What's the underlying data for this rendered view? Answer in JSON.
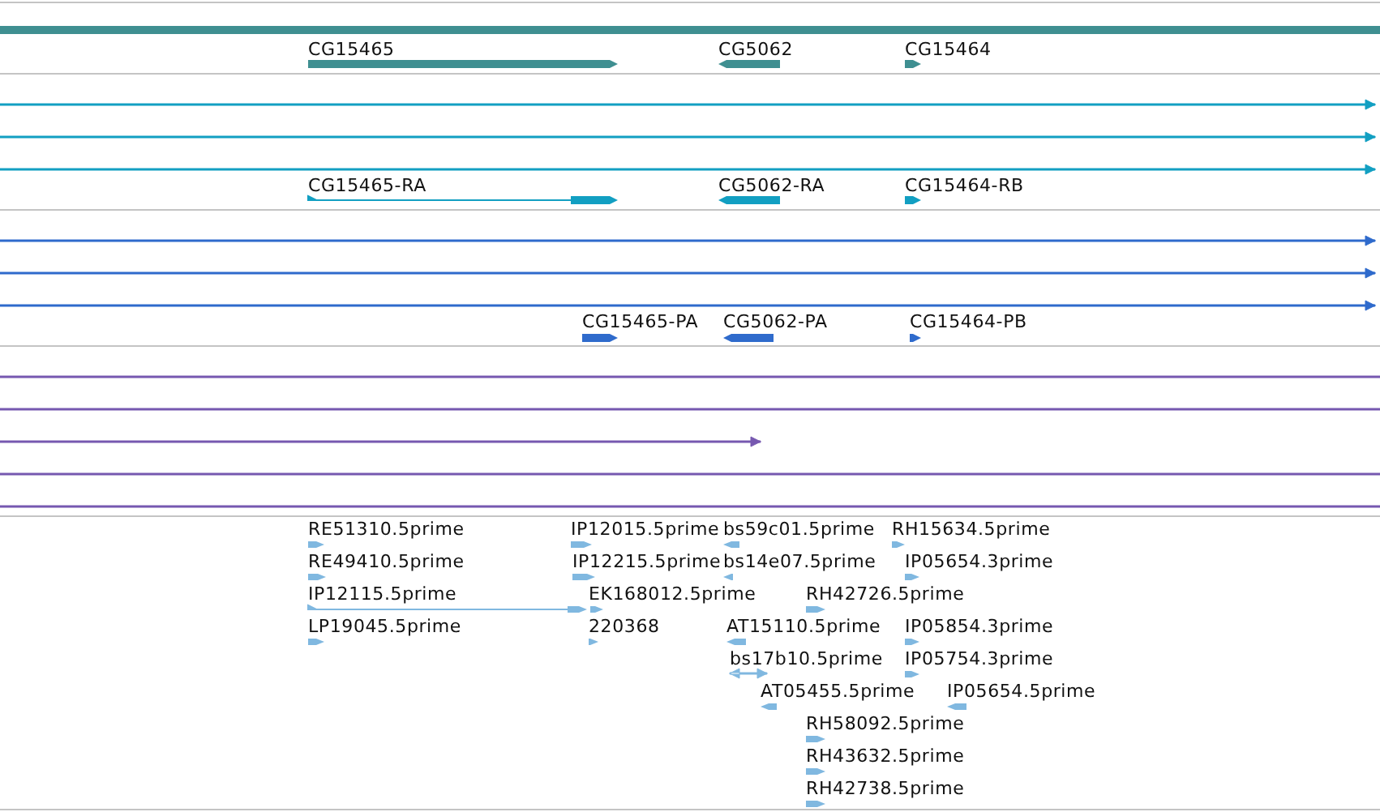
{
  "tracks": [
    {
      "kind": "gene",
      "features": [
        {
          "points_right": false,
          "points_left": false
        },
        {
          "label": "CG15465",
          "points_right": true,
          "points_left": false
        },
        {
          "label": "CG5062",
          "points_right": false,
          "points_left": true
        },
        {
          "label": "CG15464",
          "points_right": true,
          "points_left": false
        }
      ]
    },
    {
      "kind": "transcript",
      "features": [
        {
          "points_right": true,
          "points_left": false
        },
        {
          "points_right": true,
          "points_left": false
        },
        {
          "points_right": true,
          "points_left": false
        },
        {
          "label": "CG15465-RA",
          "points_right": true,
          "points_left": false
        },
        {
          "label": "CG5062-RA",
          "points_right": false,
          "points_left": true
        },
        {
          "label": "CG15464-RB",
          "points_right": true,
          "points_left": false
        }
      ]
    },
    {
      "kind": "protein",
      "features": [
        {
          "points_right": true,
          "points_left": false
        },
        {
          "points_right": true,
          "points_left": false
        },
        {
          "points_right": true,
          "points_left": false
        },
        {
          "label": "CG15465-PA",
          "points_right": true,
          "points_left": false
        },
        {
          "label": "CG5062-PA",
          "points_right": false,
          "points_left": true
        },
        {
          "label": "CG15464-PB",
          "points_right": true,
          "points_left": false
        }
      ]
    },
    {
      "kind": "alignment",
      "features": [
        {
          "points_right": false,
          "points_left": false
        },
        {
          "points_right": false,
          "points_left": false
        },
        {
          "points_right": true,
          "points_left": false
        },
        {
          "points_right": false,
          "points_left": false
        },
        {
          "points_right": false,
          "points_left": false
        }
      ]
    },
    {
      "kind": "est",
      "features": [
        {
          "label": "RE51310.5prime",
          "points_right": true,
          "points_left": false
        },
        {
          "label": "RE49410.5prime",
          "points_right": true,
          "points_left": false
        },
        {
          "label": "IP12115.5prime",
          "points_right": true,
          "points_left": false
        },
        {
          "label": "LP19045.5prime",
          "points_right": true,
          "points_left": false
        },
        {
          "label": "IP12015.5prime",
          "points_right": true,
          "points_left": false
        },
        {
          "label": "IP12215.5prime",
          "points_right": true,
          "points_left": false
        },
        {
          "label": "EK168012.5prime",
          "points_right": true,
          "points_left": false
        },
        {
          "label": "220368",
          "points_right": true,
          "points_left": false
        },
        {
          "label": "bs59c01.5prime",
          "points_right": false,
          "points_left": true
        },
        {
          "label": "bs14e07.5prime",
          "points_right": false,
          "points_left": true
        },
        {
          "label": "AT15110.5prime",
          "points_right": false,
          "points_left": true
        },
        {
          "label": "bs17b10.5prime",
          "points_right": true,
          "points_left": true
        },
        {
          "label": "AT05455.5prime",
          "points_right": false,
          "points_left": true
        },
        {
          "label": "RH15634.5prime",
          "points_right": true,
          "points_left": false
        },
        {
          "label": "IP05654.3prime",
          "points_right": true,
          "points_left": false
        },
        {
          "label": "RH42726.5prime",
          "points_right": true,
          "points_left": false
        },
        {
          "label": "IP05854.3prime",
          "points_right": true,
          "points_left": false
        },
        {
          "label": "IP05754.3prime",
          "points_right": true,
          "points_left": false
        },
        {
          "label": "IP05654.5prime",
          "points_right": false,
          "points_left": true
        },
        {
          "label": "RH58092.5prime",
          "points_right": true,
          "points_left": false
        },
        {
          "label": "RH43632.5prime",
          "points_right": true,
          "points_left": false
        },
        {
          "label": "RH42738.5prime",
          "points_right": true,
          "points_left": false
        }
      ]
    }
  ]
}
